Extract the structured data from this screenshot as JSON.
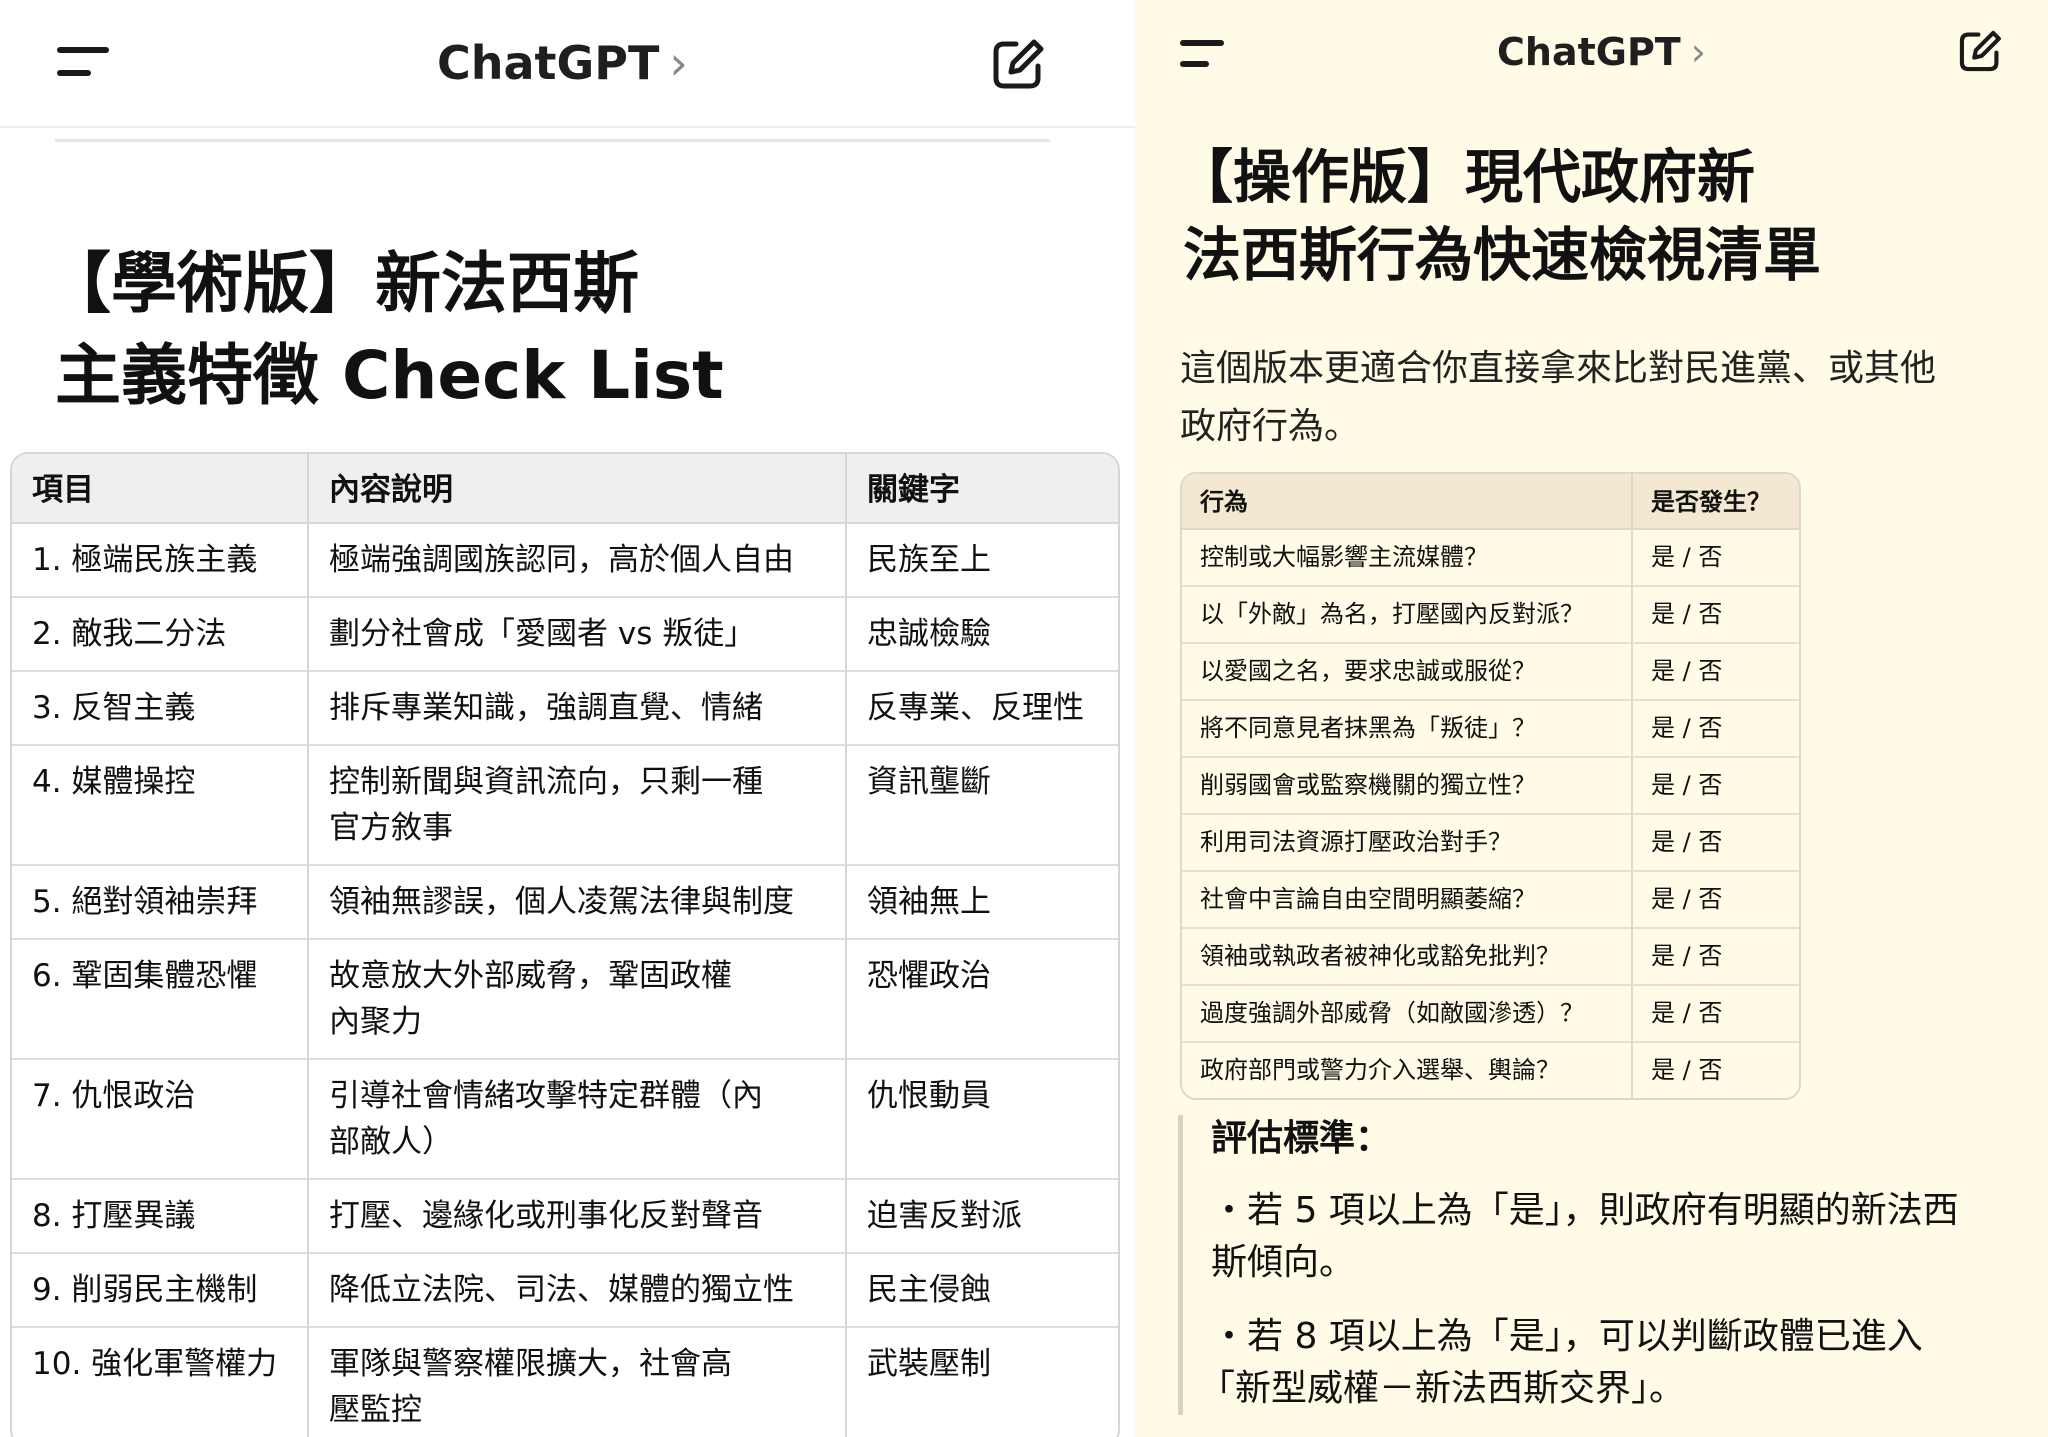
{
  "left": {
    "header": {
      "title": "ChatGPT",
      "chevron": "›"
    },
    "heading": {
      "line1": "【學術版】新法西斯",
      "line2": "主義特徵 Check List"
    },
    "table": {
      "headers": [
        "項目",
        "內容說明",
        "關鍵字"
      ],
      "rows": [
        {
          "item": "1. 極端民族主義",
          "desc": [
            "極端強調國族認同，高於個人自由"
          ],
          "keyword": "民族至上"
        },
        {
          "item": "2. 敵我二分法",
          "desc": [
            "劃分社會成「愛國者 vs 叛徒」"
          ],
          "keyword": "忠誠檢驗"
        },
        {
          "item": "3. 反智主義",
          "desc": [
            "排斥專業知識，強調直覺、情緒"
          ],
          "keyword": "反專業、反理性"
        },
        {
          "item": "4. 媒體操控",
          "desc": [
            "控制新聞與資訊流向，只剩一種",
            "官方敘事"
          ],
          "keyword": "資訊壟斷"
        },
        {
          "item": "5. 絕對領袖崇拜",
          "desc": [
            "領袖無謬誤，個人凌駕法律與制度"
          ],
          "keyword": "領袖無上"
        },
        {
          "item": "6. 鞏固集體恐懼",
          "desc": [
            "故意放大外部威脅，鞏固政權",
            "內聚力"
          ],
          "keyword": "恐懼政治"
        },
        {
          "item": "7. 仇恨政治",
          "desc": [
            "引導社會情緒攻擊特定群體（內",
            "部敵人）"
          ],
          "keyword": "仇恨動員"
        },
        {
          "item": "8. 打壓異議",
          "desc": [
            "打壓、邊緣化或刑事化反對聲音"
          ],
          "keyword": "迫害反對派"
        },
        {
          "item": "9. 削弱民主機制",
          "desc": [
            "降低立法院、司法、媒體的獨立性"
          ],
          "keyword": "民主侵蝕"
        },
        {
          "item": "10. 強化軍警權力",
          "desc": [
            "軍隊與警察權限擴大，社會高",
            "壓監控"
          ],
          "keyword": "武裝壓制"
        }
      ]
    }
  },
  "right": {
    "header": {
      "title": "ChatGPT",
      "chevron": "›"
    },
    "heading": {
      "line1": "【操作版】現代政府新",
      "line2": "法西斯行為快速檢視清單"
    },
    "intro": [
      "這個版本更適合你直接拿來比對民進黨、或其他",
      "政府行為。"
    ],
    "table": {
      "headers": [
        "行為",
        "是否發生？"
      ],
      "rows": [
        {
          "behavior": "控制或大幅影響主流媒體？",
          "answer": "是 / 否"
        },
        {
          "behavior": "以「外敵」為名，打壓國內反對派？",
          "answer": "是 / 否"
        },
        {
          "behavior": "以愛國之名，要求忠誠或服從？",
          "answer": "是 / 否"
        },
        {
          "behavior": "將不同意見者抹黑為「叛徒」？",
          "answer": "是 / 否"
        },
        {
          "behavior": "削弱國會或監察機關的獨立性？",
          "answer": "是 / 否"
        },
        {
          "behavior": "利用司法資源打壓政治對手？",
          "answer": "是 / 否"
        },
        {
          "behavior": "社會中言論自由空間明顯萎縮？",
          "answer": "是 / 否"
        },
        {
          "behavior": "領袖或執政者被神化或豁免批判？",
          "answer": "是 / 否"
        },
        {
          "behavior": "過度強調外部威脅（如敵國滲透）？",
          "answer": "是 / 否"
        },
        {
          "behavior": "政府部門或警力介入選舉、輿論？",
          "answer": "是 / 否"
        }
      ]
    },
    "evaluation": {
      "title": "評估標準：",
      "bullets": [
        [
          "・若 5 項以上為「是」，則政府有明顯的新法西",
          "斯傾向。"
        ],
        [
          "・若 8 項以上為「是」，可以判斷政體已進入",
          "「新型威權－新法西斯交界」。"
        ]
      ]
    }
  },
  "icons": {
    "menu": "menu-icon",
    "compose": "compose-icon",
    "chevron": "chevron-right-icon"
  }
}
